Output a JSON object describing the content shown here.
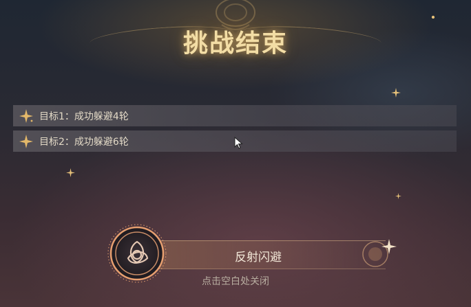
{
  "title": "挑战结束",
  "objectives": [
    {
      "label": "目标1：成功躲避4轮"
    },
    {
      "label": "目标2：成功躲避6轮"
    }
  ],
  "reward": {
    "name": "反射闪避",
    "icon": "triquetra-emblem-icon"
  },
  "close_hint": "点击空白处关闭",
  "colors": {
    "title": "#f3dda5",
    "accent_gold": "#e3b86a",
    "reward_ring": "#e8a070"
  }
}
